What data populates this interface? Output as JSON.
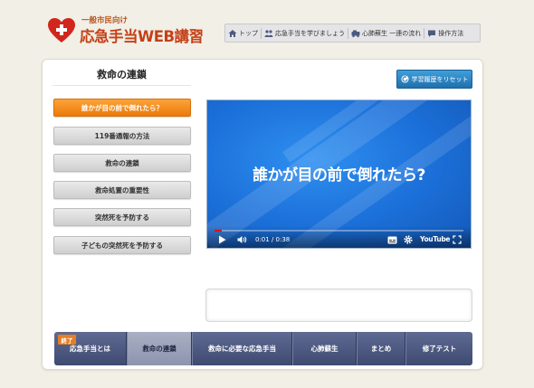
{
  "header": {
    "logo_subtitle": "一般市民向け",
    "logo_title": "応急手当WEB講習",
    "nav": [
      {
        "label": "トップ",
        "icon": "home-icon"
      },
      {
        "label": "応急手当を学びましょう",
        "icon": "people-icon"
      },
      {
        "label": "心肺蘇生 一連の流れ",
        "icon": "car-icon"
      },
      {
        "label": "操作方法",
        "icon": "chat-icon"
      }
    ]
  },
  "section_title": "救命の連鎖",
  "reset_button": "学習履歴をリセット",
  "menu": [
    {
      "label": "誰かが目の前で倒れたら？",
      "active": true
    },
    {
      "label": "119番通報の方法",
      "active": false
    },
    {
      "label": "救命の連鎖",
      "active": false
    },
    {
      "label": "救命処置の重要性",
      "active": false
    },
    {
      "label": "突然死を予防する",
      "active": false
    },
    {
      "label": "子どもの突然死を予防する",
      "active": false
    }
  ],
  "video": {
    "title": "誰かが目の前で倒れたら?",
    "time": "0:01 / 0:38",
    "progress": 0.03,
    "brand": "YouTube"
  },
  "bottom_nav": {
    "done_badge": "終了",
    "tabs": [
      {
        "label": "応急手当とは",
        "active": false
      },
      {
        "label": "救命の連鎖",
        "active": true
      },
      {
        "label": "救命に必要な応急手当",
        "active": false
      },
      {
        "label": "心肺蘇生",
        "active": false
      },
      {
        "label": "まとめ",
        "active": false
      },
      {
        "label": "修了テスト",
        "active": false
      }
    ]
  },
  "colors": {
    "accent_orange": "#ec7a08",
    "logo_red": "#c63f16",
    "nav_navy": "#3f4a71",
    "reset_blue": "#1f6fae"
  }
}
